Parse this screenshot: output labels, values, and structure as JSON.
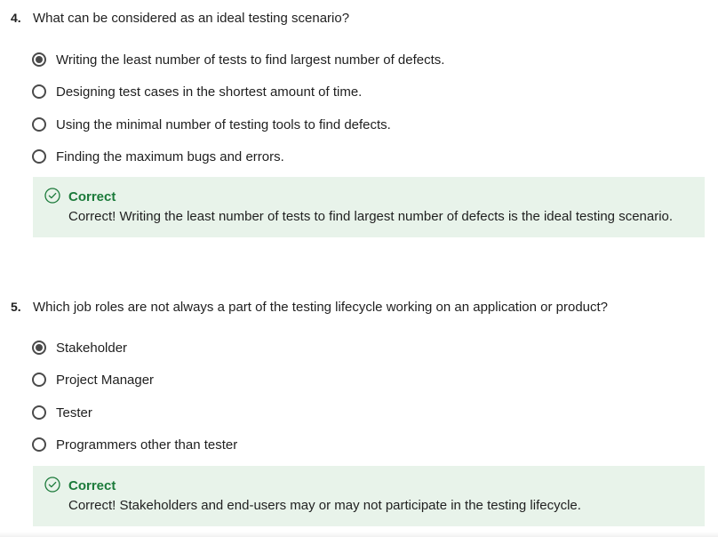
{
  "questions": [
    {
      "number": "4.",
      "text": "What can be considered as an ideal testing scenario?",
      "options": [
        {
          "label": "Writing the least number of tests to find largest number of defects.",
          "selected": true
        },
        {
          "label": "Designing test cases in the shortest amount of time.",
          "selected": false
        },
        {
          "label": "Using the minimal number of testing tools to find defects.",
          "selected": false
        },
        {
          "label": "Finding the maximum bugs and errors.",
          "selected": false
        }
      ],
      "feedback": {
        "icon": "check-circle-icon",
        "title": "Correct",
        "text": "Correct! Writing the least number of tests to find largest number of defects is the ideal testing scenario."
      }
    },
    {
      "number": "5.",
      "text": "Which job roles are not always a part of the testing lifecycle working on an application or product?",
      "options": [
        {
          "label": "Stakeholder",
          "selected": true
        },
        {
          "label": "Project Manager",
          "selected": false
        },
        {
          "label": "Tester",
          "selected": false
        },
        {
          "label": "Programmers other than tester",
          "selected": false
        }
      ],
      "feedback": {
        "icon": "check-circle-icon",
        "title": "Correct",
        "text": "Correct! Stakeholders and end-users may or may not participate in the testing lifecycle."
      }
    }
  ],
  "colors": {
    "correct_accent": "#1b7a3a",
    "feedback_background": "#e8f3ea",
    "radio_border": "#4a4a4a"
  }
}
